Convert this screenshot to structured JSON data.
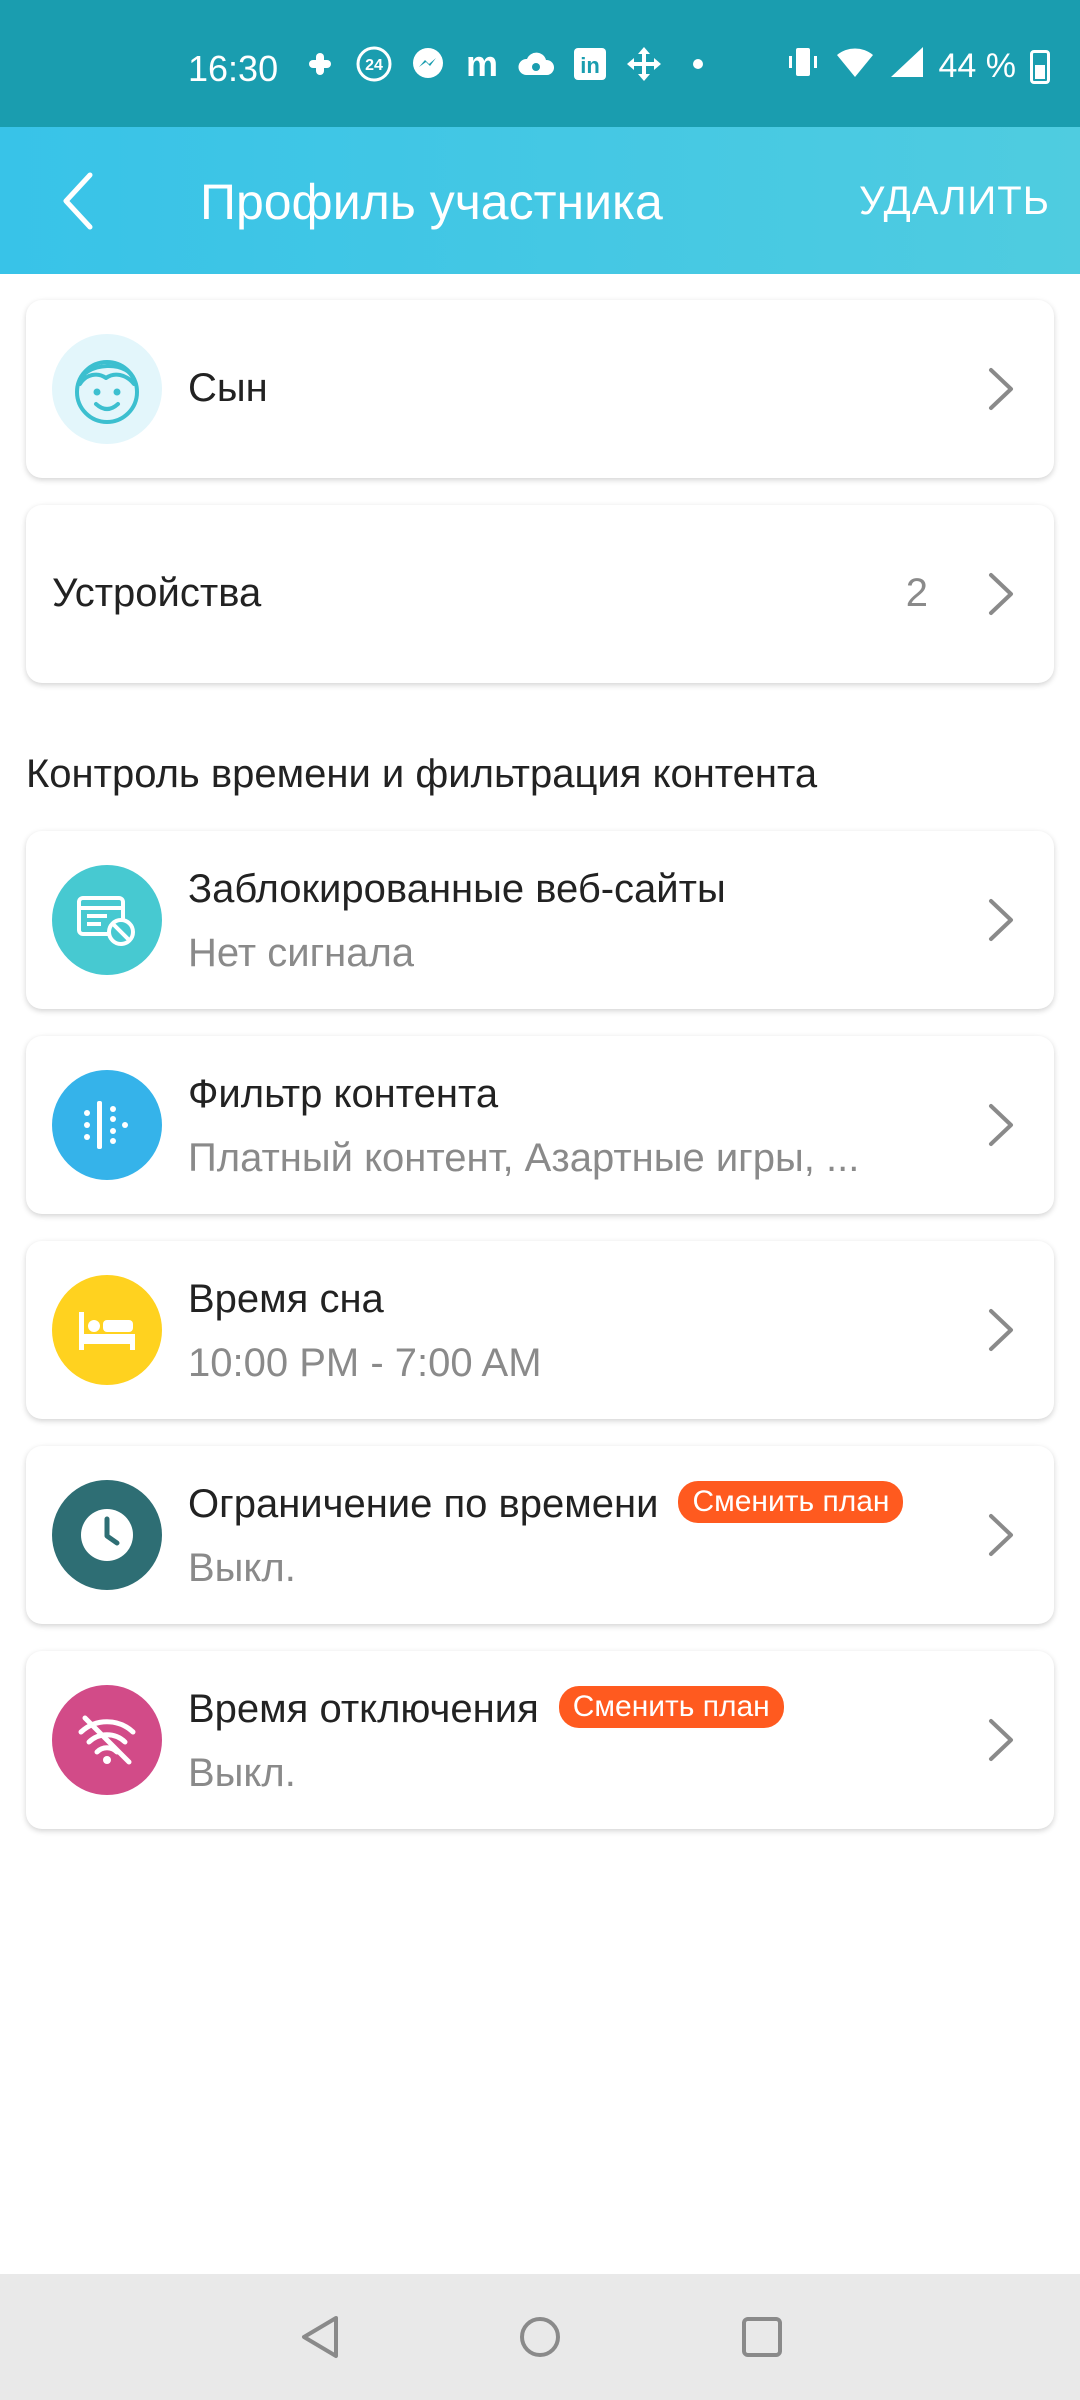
{
  "status_bar": {
    "time": "16:30",
    "battery": "44 %",
    "icons": [
      "slack-icon",
      "24-icon",
      "messenger-icon",
      "m-icon",
      "cloud-icon",
      "linkedin-icon",
      "move-icon",
      "dot-icon",
      "vibrate-icon",
      "wifi-icon",
      "signal-icon",
      "battery-icon"
    ]
  },
  "appbar": {
    "title": "Профиль участника",
    "action": "УДАЛИТЬ"
  },
  "profile": {
    "name": "Сын"
  },
  "devices": {
    "label": "Устройства",
    "count": "2"
  },
  "section": {
    "title": "Контроль времени и фильтрация контента"
  },
  "items": [
    {
      "title": "Заблокированные веб-сайты",
      "subtitle": "Нет сигнала",
      "color": "#47c9d1",
      "icon": "blocked-website-icon"
    },
    {
      "title": "Фильтр контента",
      "subtitle": "Платный контент, Азартные игры, ...",
      "color": "#35b3ea",
      "icon": "filter-icon"
    },
    {
      "title": "Время сна",
      "subtitle": "10:00 PM - 7:00 AM",
      "color": "#ffd21f",
      "icon": "bed-icon"
    },
    {
      "title": "Ограничение по времени",
      "subtitle": "Выкл.",
      "badge": "Сменить план",
      "color": "#2e6e74",
      "icon": "clock-icon"
    },
    {
      "title": "Время отключения",
      "subtitle": "Выкл.",
      "badge": "Сменить план",
      "color": "#d24b88",
      "icon": "wifi-off-icon"
    }
  ],
  "colors": {
    "status_bar": "#1a9daf",
    "appbar_start": "#38c3e8",
    "appbar_end": "#4fcce0",
    "badge": "#ff5a1f"
  }
}
